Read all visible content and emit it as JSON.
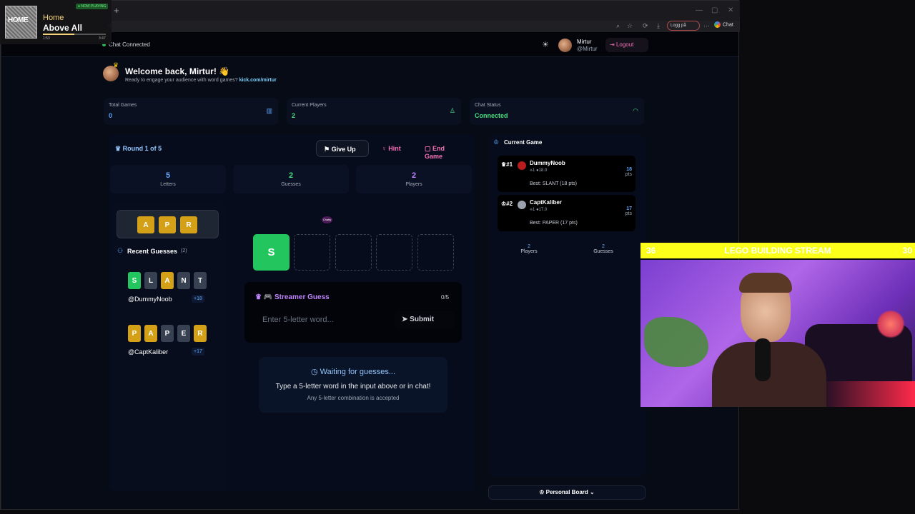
{
  "now_playing": {
    "badge": "● NOW PLAYING",
    "art_text": "HOME",
    "album": "Home",
    "title": "Above All",
    "elapsed": "1:53",
    "duration": "3:47",
    "progress": 0.5
  },
  "browser": {
    "new_tab": "+",
    "address": "d",
    "login_pill": "Logg på",
    "chat_pill": "Chat"
  },
  "header": {
    "chat_status": "Chat Connected",
    "user_name": "Mirtur",
    "user_handle": "@Mirtur",
    "logout": "Logout"
  },
  "welcome": {
    "title": "Welcome back, Mirtur! 👋",
    "subtitle": "Ready to engage your audience with word games?",
    "link": "kick.com/mirtur"
  },
  "stats": [
    {
      "label": "Total Games",
      "value": "0",
      "color": "#60a5fa",
      "icon": "bar-chart-icon"
    },
    {
      "label": "Current Players",
      "value": "2",
      "color": "#4ade80",
      "icon": "user-icon"
    },
    {
      "label": "Chat Status",
      "value": "Connected",
      "color": "#4ade80",
      "icon": "wifi-icon"
    }
  ],
  "game": {
    "round": "Round 1 of 5",
    "give_up": "Give Up",
    "hint": "Hint",
    "end_game": "End Game",
    "letters": {
      "value": "5",
      "label": "Letters"
    },
    "guesses": {
      "value": "2",
      "label": "Guesses"
    },
    "players": {
      "value": "2",
      "label": "Players"
    },
    "revealed": [
      "A",
      "P",
      "R"
    ],
    "current_letters": [
      "S",
      "",
      "",
      "",
      ""
    ],
    "chatty_badge": "Chatty"
  },
  "recent_guesses": {
    "title": "Recent Guesses",
    "count": "(2)",
    "items": [
      {
        "letters": [
          {
            "l": "S",
            "s": "g"
          },
          {
            "l": "L",
            "s": "d"
          },
          {
            "l": "A",
            "s": "y"
          },
          {
            "l": "N",
            "s": "d"
          },
          {
            "l": "T",
            "s": "d"
          }
        ],
        "user": "@DummyNoob",
        "pts": "+18"
      },
      {
        "letters": [
          {
            "l": "P",
            "s": "y"
          },
          {
            "l": "A",
            "s": "y"
          },
          {
            "l": "P",
            "s": "d"
          },
          {
            "l": "E",
            "s": "d"
          },
          {
            "l": "R",
            "s": "y"
          }
        ],
        "user": "@CaptKaliber",
        "pts": "+17"
      }
    ]
  },
  "streamer_guess": {
    "title": "🎮 Streamer Guess",
    "count": "0/5",
    "placeholder": "Enter 5-letter word...",
    "submit": "Submit"
  },
  "waiting": {
    "title": "Waiting for guesses...",
    "body": "Type a 5-letter word in the input above or in chat!",
    "sub": "Any 5-letter combination is accepted"
  },
  "current_game": {
    "title": "Current Game",
    "players": [
      {
        "rank": "#1",
        "name": "DummyNoob",
        "sub": "⟡1 ●18.0",
        "best": "Best: SLANT (18 pts)",
        "pts": "18",
        "pts_label": "pts"
      },
      {
        "rank": "#2",
        "name": "CaptKaliber",
        "sub": "⟡1 ●17.0",
        "best": "Best: PAPER (17 pts)",
        "pts": "17",
        "pts_label": "pts"
      }
    ],
    "players_count": {
      "value": "2",
      "label": "Players"
    },
    "guesses_count": {
      "value": "2",
      "label": "Guesses"
    }
  },
  "personal_board": "Personal Board",
  "stream_banner": {
    "left": "36",
    "title": "LEGO BUILDING STREAM",
    "right": "30"
  }
}
